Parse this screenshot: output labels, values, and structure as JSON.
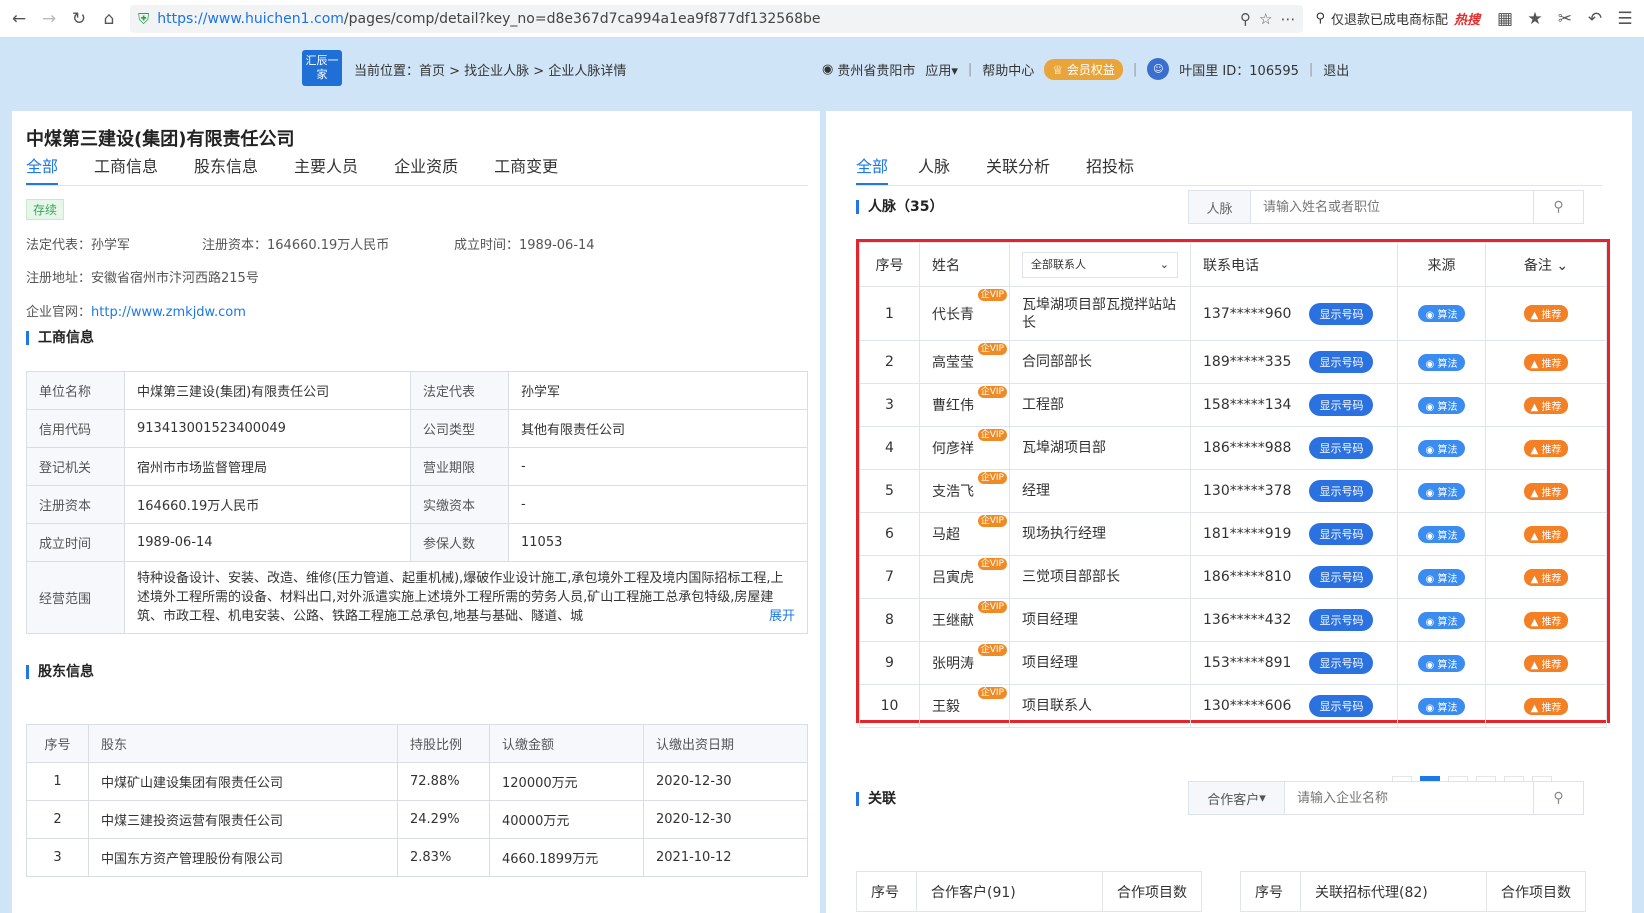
{
  "browser": {
    "url_host": "https://www.huichen1.com",
    "url_path": "/pages/comp/detail?key_no=d8e367d7ca994a1ea9f877df132568be",
    "search_text": "仅退款已成电商标配",
    "hot_label": "热搜"
  },
  "header": {
    "logo_text": "汇辰一家",
    "breadcrumb": "当前位置：首页 > 找企业人脉 > 企业人脉详情",
    "location": "贵州省贵阳市",
    "apps": "应用",
    "help": "帮助中心",
    "member": "会员权益",
    "user": "叶国里 ID：106595",
    "logout": "退出"
  },
  "company": {
    "name": "中煤第三建设(集团)有限责任公司",
    "tabs": [
      "全部",
      "工商信息",
      "股东信息",
      "主要人员",
      "企业资质",
      "工商变更"
    ],
    "status": "存续",
    "legal_rep": "法定代表：孙学军",
    "reg_capital": "注册资本：164660.19万人民币",
    "founded": "成立时间：1989-06-14",
    "address": "注册地址：安徽省宿州市汴河西路215号",
    "website_label": "企业官网：",
    "website": "http://www.zmkjdw.com"
  },
  "business": {
    "title": "工商信息",
    "rows": [
      [
        "单位名称",
        "中煤第三建设(集团)有限责任公司",
        "法定代表",
        "孙学军"
      ],
      [
        "信用代码",
        "913413001523400049",
        "公司类型",
        "其他有限责任公司"
      ],
      [
        "登记机关",
        "宿州市市场监督管理局",
        "营业期限",
        "-"
      ],
      [
        "注册资本",
        "164660.19万人民币",
        "实缴资本",
        "-"
      ],
      [
        "成立时间",
        "1989-06-14",
        "参保人数",
        "11053"
      ]
    ],
    "scope_label": "经营范围",
    "scope": "特种设备设计、安装、改造、维修(压力管道、起重机械),爆破作业设计施工,承包境外工程及境内国际招标工程,上述境外工程所需的设备、材料出口,对外派遣实施上述境外工程所需的劳务人员,矿山工程施工总承包特级,房屋建筑、市政工程、机电安装、公路、铁路工程施工总承包,地基与基础、隧道、城",
    "expand": "展开"
  },
  "shareholders": {
    "title": "股东信息",
    "headers": [
      "序号",
      "股东",
      "持股比例",
      "认缴金额",
      "认缴出资日期"
    ],
    "rows": [
      [
        "1",
        "中煤矿山建设集团有限责任公司",
        "72.88%",
        "120000万元",
        "2020-12-30"
      ],
      [
        "2",
        "中煤三建投资运营有限责任公司",
        "24.29%",
        "40000万元",
        "2020-12-30"
      ],
      [
        "3",
        "中国东方资产管理股份有限公司",
        "2.83%",
        "4660.1899万元",
        "2021-10-12"
      ]
    ]
  },
  "right": {
    "tabs": [
      "全部",
      "人脉",
      "关联分析",
      "招投标"
    ],
    "contacts_title": "人脉（35）",
    "search_prefix": "人脉",
    "search_placeholder": "请输入姓名或者职位",
    "headers": {
      "no": "序号",
      "name": "姓名",
      "filter": "全部联系人",
      "phone": "联系电话",
      "source": "来源",
      "note": "备注"
    },
    "vip_label": "企VIP",
    "show_label": "显示号码",
    "source_label": "算法",
    "rec_label": "推荐",
    "contacts": [
      {
        "no": "1",
        "name": "代长青",
        "position": "瓦埠湖项目部瓦搅拌站站长",
        "phone": "137*****960"
      },
      {
        "no": "2",
        "name": "高莹莹",
        "position": "合同部部长",
        "phone": "189*****335"
      },
      {
        "no": "3",
        "name": "曹红伟",
        "position": "工程部",
        "phone": "158*****134"
      },
      {
        "no": "4",
        "name": "何彦祥",
        "position": "瓦埠湖项目部",
        "phone": "186*****988"
      },
      {
        "no": "5",
        "name": "支浩飞",
        "position": "经理",
        "phone": "130*****378"
      },
      {
        "no": "6",
        "name": "马超",
        "position": "现场执行经理",
        "phone": "181*****919"
      },
      {
        "no": "7",
        "name": "吕寅虎",
        "position": "三觉项目部部长",
        "phone": "186*****810"
      },
      {
        "no": "8",
        "name": "王继献",
        "position": "项目经理",
        "phone": "136*****432"
      },
      {
        "no": "9",
        "name": "张明涛",
        "position": "项目经理",
        "phone": "153*****891"
      },
      {
        "no": "10",
        "name": "王毅",
        "position": "项目联系人",
        "phone": "130*****606"
      }
    ],
    "pages": [
      "1",
      "2",
      "3",
      "4"
    ],
    "related_title": "关联",
    "related_select": "合作客户",
    "related_placeholder": "请输入企业名称",
    "related_headers_a": [
      "序号",
      "合作客户(91)",
      "合作项目数"
    ],
    "related_headers_b": [
      "序号",
      "关联招标代理(82)",
      "合作项目数"
    ]
  }
}
